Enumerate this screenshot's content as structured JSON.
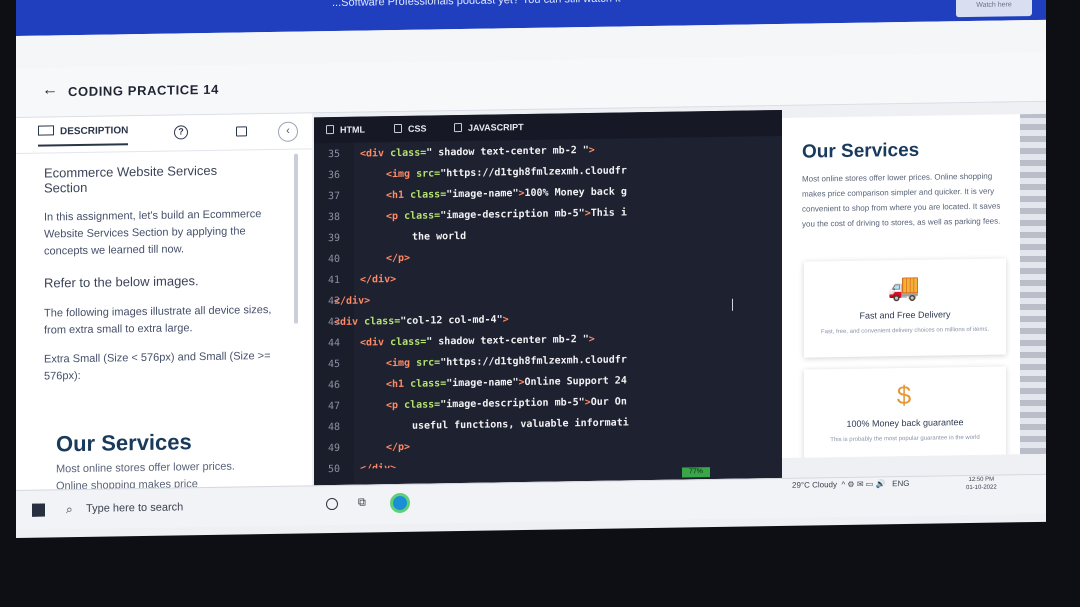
{
  "banner": {
    "text": "...Software Professionals podcast yet? You can still watch it",
    "watch_label": "Watch here"
  },
  "header": {
    "back_icon": "arrow-left-icon",
    "title": "CODING PRACTICE 14"
  },
  "left_tabs": {
    "description": "DESCRIPTION",
    "help_icon": "?",
    "collapse_icon": "‹"
  },
  "description": {
    "heading": "Ecommerce Website Services Section",
    "intro": "In this assignment, let's build an Ecommerce Website Services Section by applying the concepts we learned till now.",
    "refer": "Refer to the below images.",
    "following": "The following images illustrate all device sizes, from extra small to extra large.",
    "sizes": "Extra Small (Size < 576px) and Small (Size >= 576px):",
    "preview_title": "Our Services",
    "preview_para": "Most online stores offer lower prices. Online shopping makes price comparison simpler and quicker. It is"
  },
  "editor": {
    "tabs": [
      "HTML",
      "CSS",
      "JAVASCRIPT"
    ],
    "line_numbers": [
      "35",
      "36",
      "37",
      "38",
      "39",
      "40",
      "41",
      "42",
      "43",
      "44",
      "45",
      "46",
      "47",
      "48",
      "49",
      "50"
    ],
    "percent": "77%"
  },
  "preview": {
    "title": "Our Services",
    "text": "Most online stores offer lower prices. Online shopping makes price comparison simpler and quicker. It is very convenient to shop from where you are located. It saves you the cost of driving to stores, as well as parking fees.",
    "cards": [
      {
        "icon": "truck-icon",
        "name": "Fast and Free Delivery",
        "desc": "Fast, free, and convenient delivery choices on millions of items."
      },
      {
        "icon": "money-back-icon",
        "name": "100% Money back guarantee",
        "desc": "This is probably the most popular guarantee in the world"
      }
    ]
  },
  "taskbar": {
    "search_placeholder": "Type here to search",
    "weather": "29°C Cloudy",
    "lang": "ENG",
    "time": "12:50 PM",
    "date": "01-10-2022"
  }
}
